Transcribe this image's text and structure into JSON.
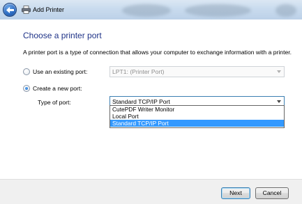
{
  "window": {
    "title": "Add Printer",
    "back_icon": "back-arrow-icon",
    "printer_icon": "printer-icon"
  },
  "main": {
    "heading": "Choose a printer port",
    "description": "A printer port is a type of connection that allows your computer to exchange information with a printer.",
    "existing_port": {
      "label": "Use an existing port:",
      "value": "LPT1: (Printer Port)",
      "checked": false,
      "enabled": false
    },
    "new_port": {
      "label": "Create a new port:",
      "checked": true,
      "type_label": "Type of port:",
      "value": "Standard TCP/IP Port",
      "options": [
        "CutePDF Writer Monitor",
        "Local Port",
        "Standard TCP/IP Port"
      ],
      "selected_option": "Standard TCP/IP Port"
    }
  },
  "footer": {
    "next_label": "Next",
    "cancel_label": "Cancel"
  },
  "colors": {
    "heading": "#1e3287",
    "selection": "#3399ff",
    "footer_bg": "#f0f0f0"
  }
}
